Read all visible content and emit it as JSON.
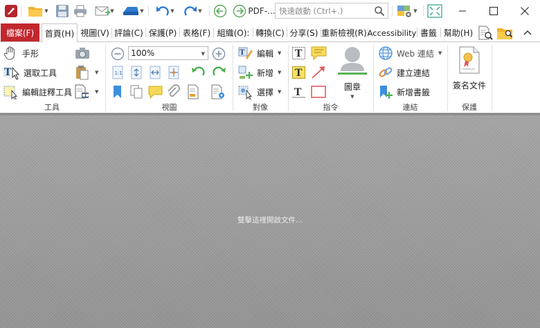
{
  "quick_access": {
    "pdf_menu_label": "PDF-...",
    "quick_launch_placeholder": "快速啟動 (Ctrl+.)"
  },
  "tabs": {
    "file": "檔案(F)",
    "home": "首頁(H)",
    "view": "視圖(V)",
    "comment": "評論(C)",
    "protect": "保護(P)",
    "form": "表格(F)",
    "organize": "組織(O):",
    "convert": "轉換(C)",
    "share": "分享(S)",
    "review": "重新檢視(R)",
    "accessibility": "Accessibility",
    "bookmarks": "書籤",
    "help": "幫助(H)"
  },
  "ribbon": {
    "tools": {
      "hand": "手形",
      "select": "選取工具",
      "edit_annotation": "編輯註釋工具",
      "group_label": "工具"
    },
    "view": {
      "zoom": "100%",
      "group_label": "視圖"
    },
    "objects": {
      "edit": "編輯",
      "add": "新增",
      "select": "選擇",
      "group_label": "對像"
    },
    "commands": {
      "stamp": "圖章",
      "group_label": "指令"
    },
    "links": {
      "web_links": "Web 連結",
      "create_link": "建立連結",
      "add_bookmark": "新增書籤",
      "group_label": "連結"
    },
    "protect": {
      "sign_document": "簽名文件",
      "group_label": "保護"
    }
  },
  "document": {
    "hint": "雙擊這裡開啟文件..."
  },
  "colors": {
    "file_tab": "#c1272d",
    "accent_blue": "#2e7bd1",
    "doc_background": "#9e9e9e"
  }
}
